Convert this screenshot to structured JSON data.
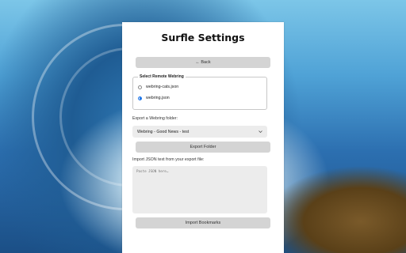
{
  "page": {
    "title": "Surfle Settings",
    "back_label": "← Back"
  },
  "remote_webring": {
    "legend": "Select Remote Webring",
    "options": [
      {
        "label": "webring-cats.json",
        "checked": false
      },
      {
        "label": "webring.json",
        "checked": true
      }
    ]
  },
  "export": {
    "label": "Export a Webring folder:",
    "selected_folder": "Webring - Good News - test",
    "button_label": "Export Folder"
  },
  "import": {
    "label": "Import JSON text from your export file:",
    "placeholder": "Paste JSON here…",
    "value": "",
    "button_label": "Import Bookmarks"
  },
  "colors": {
    "accent": "#1a73e8",
    "button_bg": "#d4d4d4",
    "field_bg": "#ececec"
  }
}
